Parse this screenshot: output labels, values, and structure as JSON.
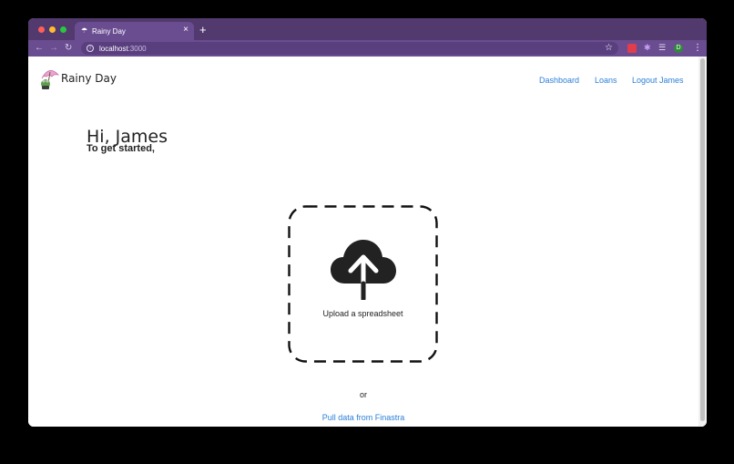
{
  "browser": {
    "tab_title": "Rainy Day",
    "tab_close": "×",
    "new_tab": "+",
    "url_host": "localhost",
    "url_port": ":3000",
    "profile_initial": "D",
    "icons": {
      "back": "arrow-left-icon",
      "forward": "arrow-right-icon",
      "reload": "reload-icon",
      "bookmark": "star-icon",
      "menu": "kebab-menu-icon"
    }
  },
  "brand": {
    "name": "Rainy Day",
    "logo": "umbrella-frog-logo"
  },
  "nav": {
    "items": [
      {
        "label": "Dashboard"
      },
      {
        "label": "Loans"
      },
      {
        "label": "Logout James"
      }
    ]
  },
  "main": {
    "greeting": "Hi, James",
    "subtitle": "To get started,",
    "upload_label": "Upload a spreadsheet",
    "upload_icon": "cloud-upload-icon",
    "or_text": "or",
    "finastra_link": "Pull data from Finastra"
  },
  "colors": {
    "titlebar": "#52396e",
    "toolbar": "#6a4d91",
    "link": "#2b7fd9",
    "icon_dark": "#222222"
  }
}
